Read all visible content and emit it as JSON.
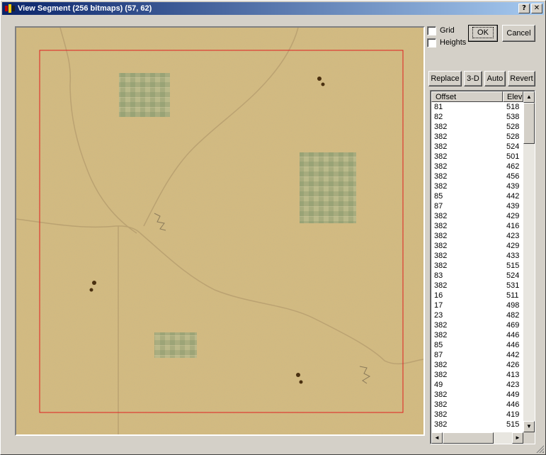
{
  "window": {
    "title": "View Segment (256 bitmaps) (57, 62)",
    "help_button": "?",
    "close_button": "✕"
  },
  "options": {
    "grid_label": "Grid",
    "grid_checked": false,
    "heights_label": "Heights",
    "heights_checked": false
  },
  "buttons": {
    "ok": "OK",
    "cancel": "Cancel",
    "replace": "Replace",
    "three_d": "3-D",
    "auto": "Auto",
    "revert": "Revert"
  },
  "table": {
    "columns": [
      "Offset",
      "Elev"
    ],
    "rows": [
      [
        "81",
        "518"
      ],
      [
        "82",
        "538"
      ],
      [
        "382",
        "528"
      ],
      [
        "382",
        "528"
      ],
      [
        "382",
        "524"
      ],
      [
        "382",
        "501"
      ],
      [
        "382",
        "462"
      ],
      [
        "382",
        "456"
      ],
      [
        "382",
        "439"
      ],
      [
        "85",
        "442"
      ],
      [
        "87",
        "439"
      ],
      [
        "382",
        "429"
      ],
      [
        "382",
        "416"
      ],
      [
        "382",
        "423"
      ],
      [
        "382",
        "429"
      ],
      [
        "382",
        "433"
      ],
      [
        "382",
        "515"
      ],
      [
        "83",
        "524"
      ],
      [
        "382",
        "531"
      ],
      [
        "16",
        "511"
      ],
      [
        "17",
        "498"
      ],
      [
        "23",
        "482"
      ],
      [
        "382",
        "469"
      ],
      [
        "382",
        "446"
      ],
      [
        "85",
        "446"
      ],
      [
        "87",
        "442"
      ],
      [
        "382",
        "426"
      ],
      [
        "382",
        "413"
      ],
      [
        "49",
        "423"
      ],
      [
        "382",
        "449"
      ],
      [
        "382",
        "446"
      ],
      [
        "382",
        "419"
      ],
      [
        "382",
        "515"
      ]
    ]
  },
  "scroll": {
    "up": "▲",
    "down": "▼",
    "left": "◄",
    "right": "►"
  },
  "colors": {
    "terrain": "#d4bb80",
    "selection_border": "#e02020",
    "field_green": "#9aa77a",
    "title_start": "#0a246a",
    "title_end": "#a6caf0"
  }
}
